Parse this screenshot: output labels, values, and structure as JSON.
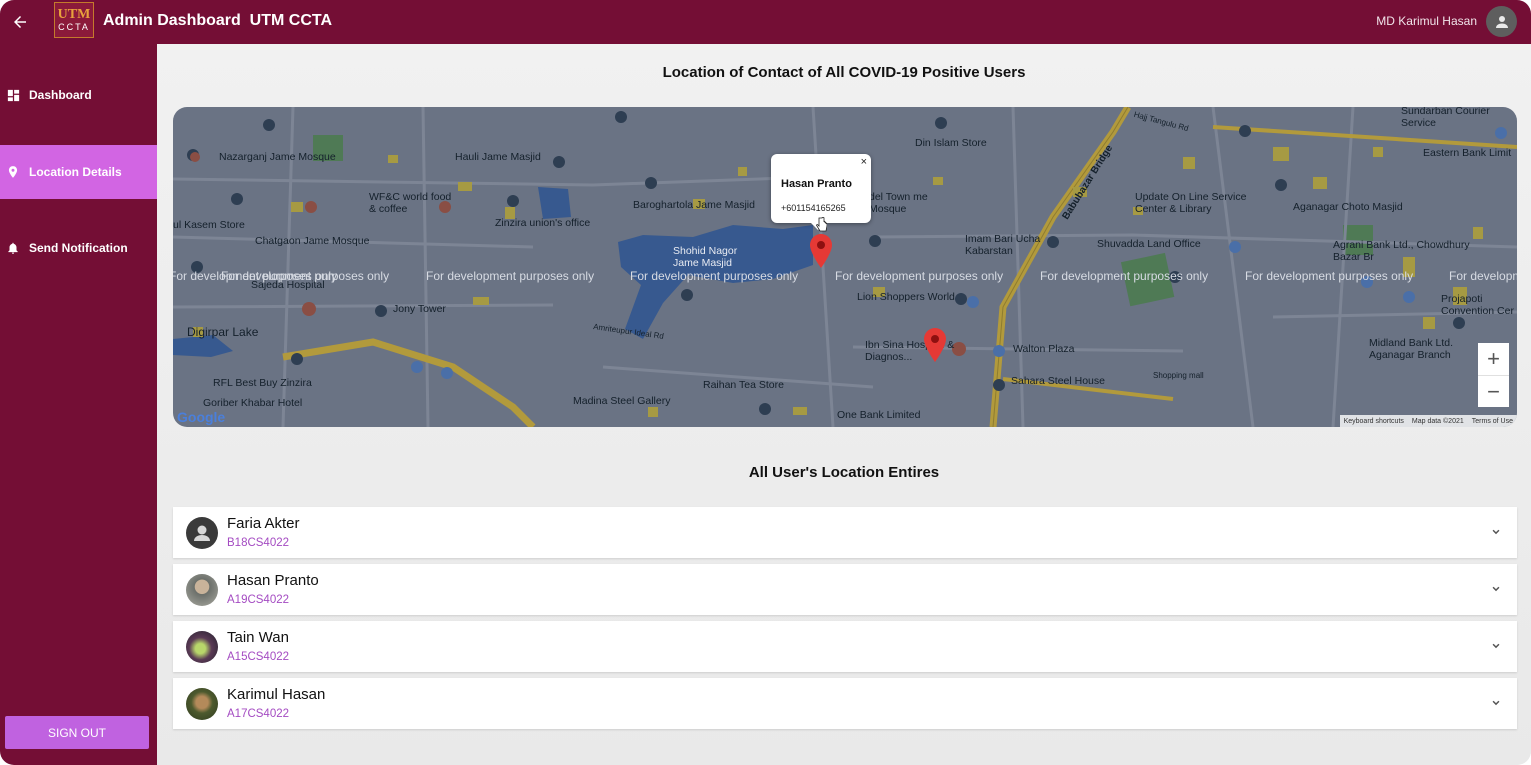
{
  "header": {
    "logo_top": "UTM",
    "logo_bottom": "CCTA",
    "title": "Admin Dashboard  UTM CCTA",
    "user_name": "MD Karimul Hasan"
  },
  "sidebar": {
    "items": [
      {
        "label": "Dashboard",
        "icon": "dashboard-icon"
      },
      {
        "label": "Location Details",
        "icon": "map-pin-icon",
        "active": true
      },
      {
        "label": "Send Notification",
        "icon": "bell-icon"
      }
    ],
    "sign_out": "SIGN OUT"
  },
  "map_section": {
    "heading": "Location of Contact of All COVID-19 Positive Users",
    "watermark": "For development purposes only",
    "popup": {
      "name": "Hasan Pranto",
      "phone": "+601154165265",
      "close": "×"
    },
    "zoom_in": "+",
    "zoom_out": "−",
    "attribution": [
      "Keyboard shortcuts",
      "Map data ©2021",
      "Terms of Use"
    ],
    "google": "Google",
    "places": [
      "Nazarganj Jame Mosque",
      "Hauli Jame Masjid",
      "Din Islam Store",
      "Hajj Tangulu Rd",
      "Sundarban Courier Service",
      "Eastern Bank Limit",
      "WF&C world food & coffee",
      "Zinzira union's office",
      "Baroghartola Jame Masjid",
      "del Town me Mosque",
      "Babubazar Bridge",
      "Update On Line Service Center & Library",
      "Aganagar Choto Masjid",
      "ul Kasem Store",
      "Chatgaon Jame Mosque",
      "Shohid Nagor Jame Masjid",
      "Imam Bari Ucha Kabarstan",
      "Shuvadda Land Office",
      "Agrani Bank Ltd., Chowdhury Bazar Br",
      "Sajeda Hospital",
      "Lion Shoppers World",
      "Projapoti Convention Cer",
      "Digirpar Lake",
      "Jony Tower",
      "Ibn Sina Hospital & Diagnos...",
      "Walton Plaza",
      "Midland Bank Ltd. Aganagar Branch",
      "Shopping mall",
      "RFL Best Buy Zinzira",
      "Raihan Tea Store",
      "Sahara Steel House",
      "Goriber Khabar Hotel",
      "Madina Steel Gallery",
      "One Bank Limited",
      "Amriteupur Ideal Rd"
    ]
  },
  "list_section": {
    "heading": "All User's Location Entires",
    "users": [
      {
        "name": "Faria Akter",
        "id": "B18CS4022"
      },
      {
        "name": "Hasan Pranto",
        "id": "A19CS4022"
      },
      {
        "name": "Tain Wan",
        "id": "A15CS4022"
      },
      {
        "name": "Karimul Hasan",
        "id": "A17CS4022"
      }
    ]
  },
  "colors": {
    "brand": "#740e35",
    "active": "#d265e3",
    "signout": "#c062e0",
    "id_text": "#a44bc2"
  }
}
